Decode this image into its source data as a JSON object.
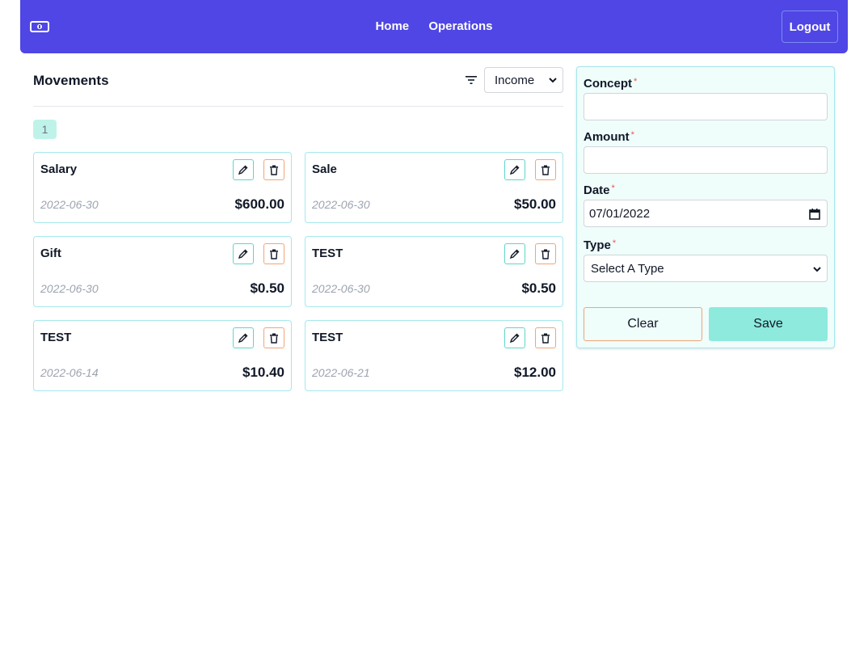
{
  "navbar": {
    "logo_icon": "banknote-icon",
    "links": [
      "Home",
      "Operations"
    ],
    "logout_label": "Logout",
    "background": "#4f46e5"
  },
  "movements": {
    "title": "Movements",
    "filter_icon": "filter-icon",
    "filter_value": "Income",
    "page": "1",
    "cards": [
      {
        "title": "Salary",
        "date": "2022-06-30",
        "amount": "$600.00"
      },
      {
        "title": "Sale",
        "date": "2022-06-30",
        "amount": "$50.00"
      },
      {
        "title": "Gift",
        "date": "2022-06-30",
        "amount": "$0.50"
      },
      {
        "title": "TEST",
        "date": "2022-06-30",
        "amount": "$0.50"
      },
      {
        "title": "TEST",
        "date": "2022-06-14",
        "amount": "$10.40"
      },
      {
        "title": "TEST",
        "date": "2022-06-21",
        "amount": "$12.00"
      }
    ]
  },
  "form": {
    "concept_label": "Concept",
    "concept_value": "",
    "amount_label": "Amount",
    "amount_value": "",
    "date_label": "Date",
    "date_value": "07/01/2022",
    "type_label": "Type",
    "type_value": "Select A Type",
    "required_mark": "*",
    "clear_label": "Clear",
    "save_label": "Save"
  },
  "colors": {
    "accent": "#4f46e5",
    "card_border": "#a5e8ec",
    "save_bg": "#8deadc",
    "delete_border": "#f0a677"
  }
}
